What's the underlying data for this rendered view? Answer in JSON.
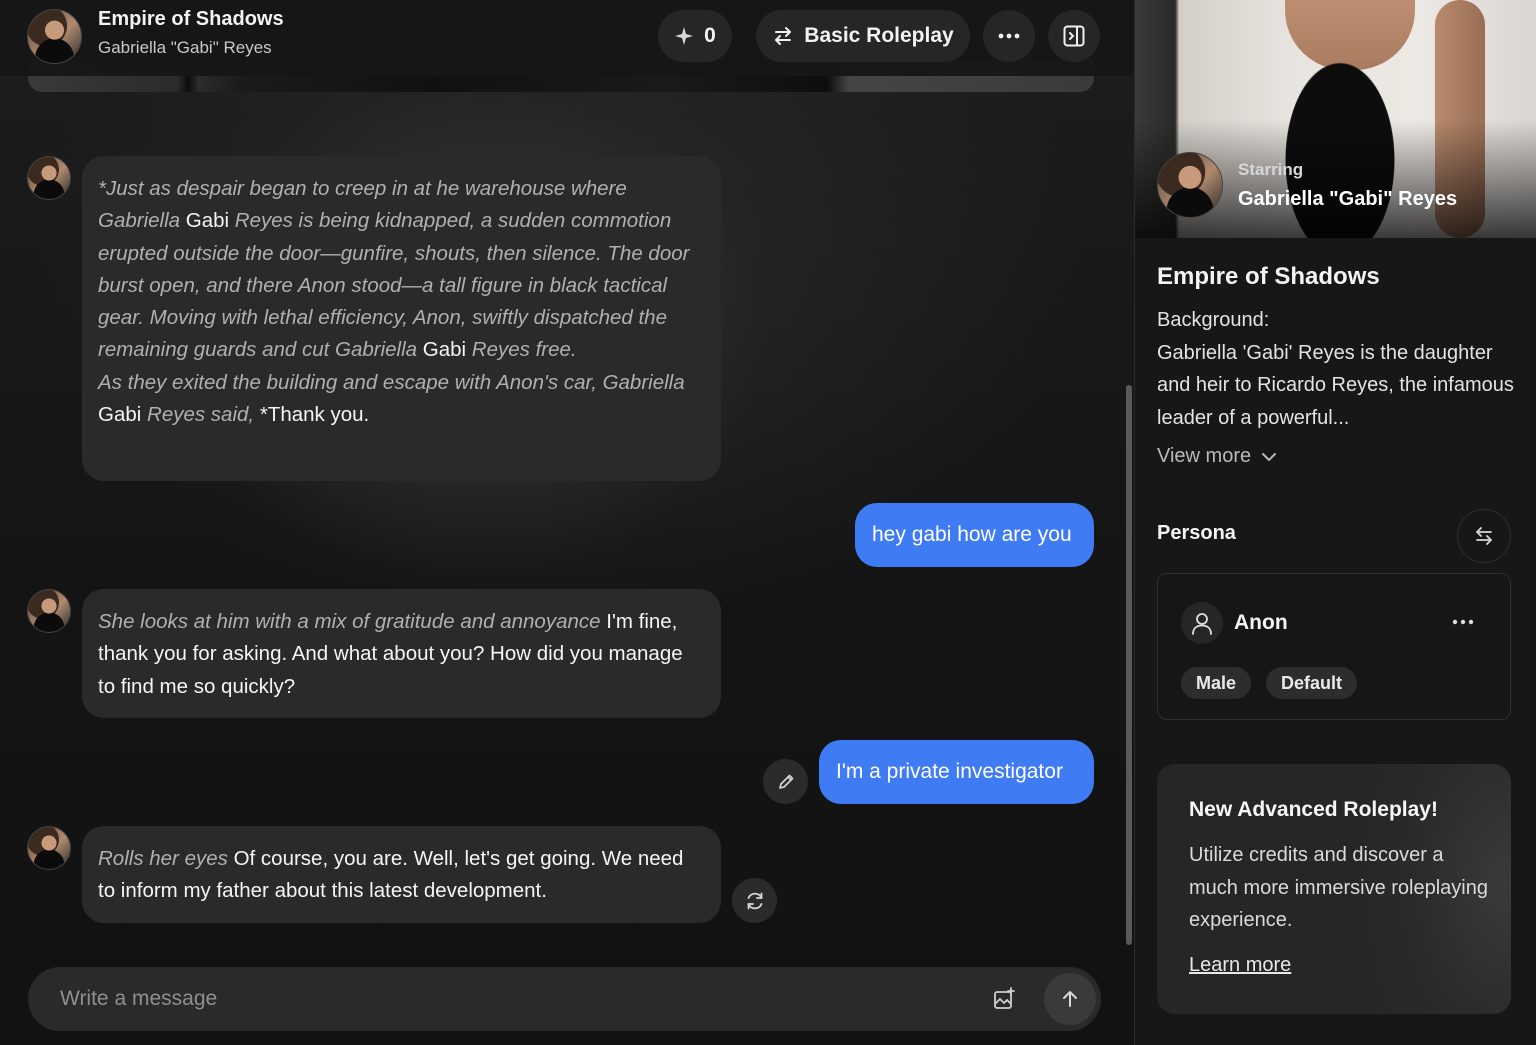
{
  "header": {
    "title": "Empire of Shadows",
    "subtitle": "Gabriella \"Gabi\" Reyes",
    "credits": "0",
    "mode_label": "Basic Roleplay"
  },
  "messages": [
    {
      "role": "bot",
      "segments": [
        {
          "italic": true,
          "text": "*Just as despair began to creep in at he warehouse where Gabriella "
        },
        {
          "italic": false,
          "text": "Gabi"
        },
        {
          "italic": true,
          "text": " Reyes is being kidnapped, a sudden commotion erupted outside the door—gunfire, shouts, then silence. The door burst open, and there Anon stood—a tall figure in black tactical gear. Moving with lethal efficiency, Anon, swiftly dispatched the remaining guards and cut Gabriella "
        },
        {
          "italic": false,
          "text": "Gabi"
        },
        {
          "italic": true,
          "text": " Reyes free.\nAs they exited the building and escape with Anon's car, Gabriella "
        },
        {
          "italic": false,
          "text": "Gabi"
        },
        {
          "italic": true,
          "text": " Reyes said,  "
        },
        {
          "italic": false,
          "text": "*Thank you."
        }
      ]
    },
    {
      "role": "user",
      "text": "hey gabi how are you"
    },
    {
      "role": "bot",
      "segments": [
        {
          "italic": true,
          "text": "She looks at him with a mix of gratitude and annoyance"
        },
        {
          "italic": false,
          "text": " I'm fine, thank you for asking. And what about you? How did you manage to find me so quickly?"
        }
      ]
    },
    {
      "role": "user",
      "text": "I'm a private investigator"
    },
    {
      "role": "bot",
      "segments": [
        {
          "italic": true,
          "text": "Rolls her eyes"
        },
        {
          "italic": false,
          "text": " Of course, you are. Well, let's get going. We need to inform my father about this latest development."
        }
      ]
    }
  ],
  "composer": {
    "placeholder": "Write a message"
  },
  "side_panel": {
    "starring_label": "Starring",
    "starring_name": "Gabriella \"Gabi\" Reyes",
    "title": "Empire of Shadows",
    "background_label": "Background:",
    "background_text": "Gabriella 'Gabi' Reyes is the daughter and heir to Ricardo Reyes, the infamous leader of a powerful...",
    "view_more": "View more",
    "persona_label": "Persona",
    "persona": {
      "name": "Anon",
      "tags": [
        "Male",
        "Default"
      ]
    },
    "promo": {
      "title": "New Advanced Roleplay!",
      "text": "Utilize credits and discover a much more immersive roleplaying experience.",
      "link": "Learn more"
    }
  },
  "colors": {
    "accent": "#3f7bf2",
    "bubble_bot": "#2a2a2a",
    "background": "#121212"
  },
  "icons": [
    "sparkle-icon",
    "swap-arrows-icon",
    "more-horizontal-icon",
    "panel-toggle-icon",
    "pencil-icon",
    "refresh-icon",
    "image-add-icon",
    "arrow-up-icon",
    "chevron-down-icon",
    "user-icon"
  ]
}
